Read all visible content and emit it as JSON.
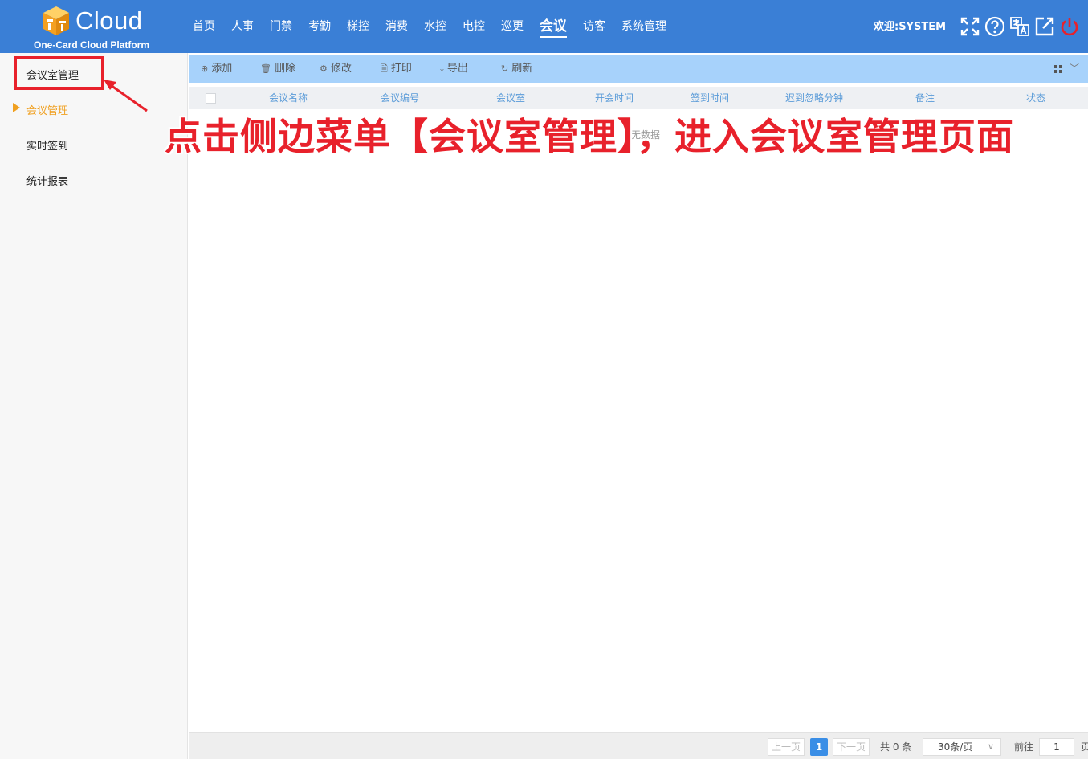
{
  "header": {
    "logo_text": "Cloud",
    "logo_subtitle": "One-Card Cloud Platform",
    "nav": [
      "首页",
      "人事",
      "门禁",
      "考勤",
      "梯控",
      "消费",
      "水控",
      "电控",
      "巡更",
      "会议",
      "访客",
      "系统管理"
    ],
    "active_nav": "会议",
    "welcome": "欢迎:SYSTEM",
    "icons": [
      "fullscreen-icon",
      "help-icon",
      "translate-icon",
      "external-link-icon",
      "power-icon"
    ]
  },
  "sidebar": {
    "items": [
      "会议室管理",
      "会议管理",
      "实时签到",
      "统计报表"
    ],
    "active_item": "会议管理"
  },
  "toolbar": {
    "add": "添加",
    "delete": "删除",
    "edit": "修改",
    "print": "打印",
    "export": "导出",
    "refresh": "刷新"
  },
  "table": {
    "columns": [
      "会议名称",
      "会议编号",
      "会议室",
      "开会时间",
      "签到时间",
      "迟到忽略分钟",
      "备注",
      "状态"
    ],
    "empty_text": "无数据"
  },
  "annotation": {
    "text": "点击侧边菜单【会议室管理】，进入会议室管理页面",
    "color": "#e8212b"
  },
  "pagination": {
    "prev": "上一页",
    "current_page": "1",
    "next": "下一页",
    "total": "共 0 条",
    "page_size": "30条/页",
    "goto_label": "前往",
    "goto_value": "1",
    "page_suffix": "页"
  },
  "colors": {
    "header_bg": "#3a7fd6",
    "toolbar_bg": "#a7d2fb",
    "accent_orange": "#f0a020",
    "page_active": "#3a8ee6"
  }
}
